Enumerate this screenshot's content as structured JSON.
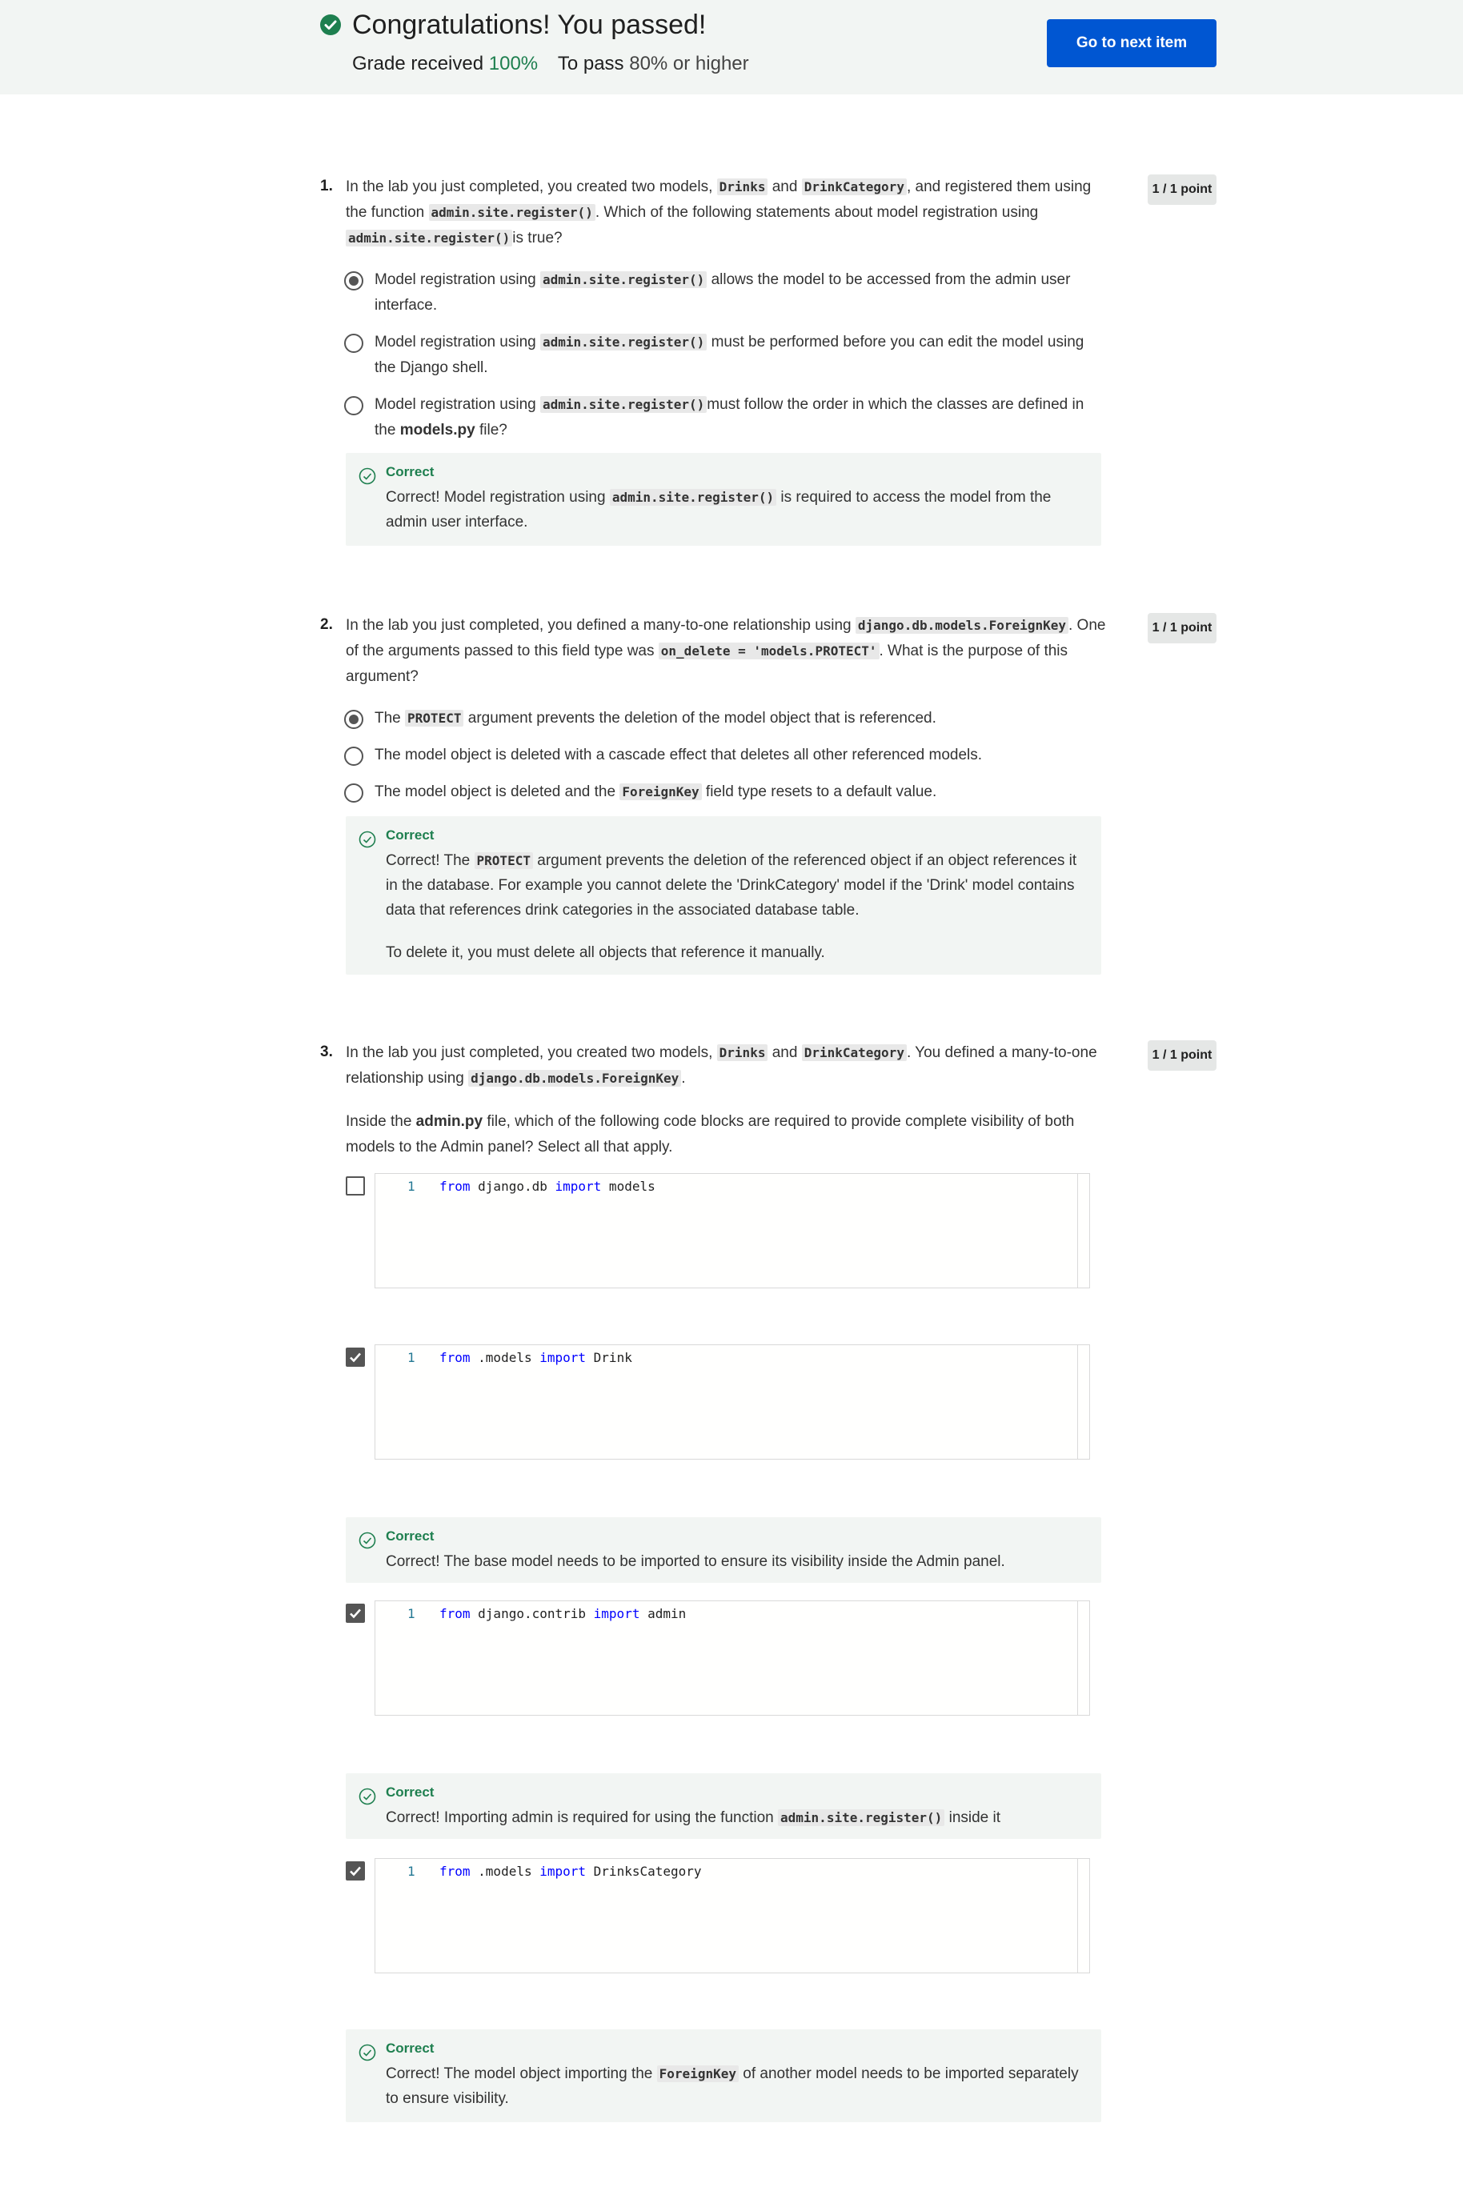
{
  "header": {
    "title": "Congratulations! You passed!",
    "grade_label": "Grade received",
    "grade_value": "100%",
    "pass_label": "To pass",
    "pass_value": "80% or higher",
    "next_button": "Go to next item"
  },
  "colors": {
    "accent": "#0056d2",
    "correct": "#1e7f4f",
    "header_bg": "#f2f5f3"
  },
  "questions": [
    {
      "number": "1.",
      "points": "1 / 1 point",
      "text_a": "In the lab you just completed, you created two models, ",
      "code_a": "Drinks",
      "text_b": " and ",
      "code_b": "DrinkCategory",
      "text_c": ", and registered them using the function ",
      "code_c": "admin.site.register()",
      "text_d": ". Which of the following statements about model registration using ",
      "code_d": "admin.site.register()",
      "text_e": "is true?",
      "options": [
        {
          "pre": "Model registration using ",
          "code": "admin.site.register()",
          "post": " allows the model to be accessed from the admin user interface."
        },
        {
          "pre": "Model registration using ",
          "code": "admin.site.register()",
          "post": " must be performed before you can edit the model using the Django shell."
        },
        {
          "pre": "Model registration using ",
          "code": "admin.site.register()",
          "post": "must follow the order in which the classes are defined in the ",
          "bold": "models.py",
          "post2": " file?"
        }
      ],
      "feedback": {
        "label": "Correct",
        "pre": "Correct! Model registration using ",
        "code": "admin.site.register()",
        "post": " is required to access the model from the admin user interface."
      }
    },
    {
      "number": "2.",
      "points": "1 / 1 point",
      "text_a": "In the lab you just completed, you defined a many-to-one relationship using ",
      "code_a": "django.db.models.ForeignKey",
      "text_b": ". One of the arguments passed to this field type was ",
      "code_b": "on_delete = 'models.PROTECT'",
      "text_c": ". What is the purpose of this argument?",
      "options": [
        {
          "pre": "The ",
          "code": "PROTECT",
          "post": " argument prevents the deletion of the model object that is referenced."
        },
        {
          "pre": "The model object is deleted with a cascade effect that deletes all other referenced models."
        },
        {
          "pre": "The model object is deleted and the ",
          "code": "ForeignKey",
          "post": " field type resets to a default value."
        }
      ],
      "feedback": {
        "label": "Correct",
        "pre": "Correct! The ",
        "code": "PROTECT",
        "post": " argument prevents the deletion of the referenced object if an object references it in the database. For example you cannot delete the 'DrinkCategory' model if the 'Drink' model contains data that references drink categories in the associated database table.",
        "para2": "To delete it, you must delete all objects that reference it manually."
      }
    },
    {
      "number": "3.",
      "points": "1 / 1 point",
      "text_a": "In the lab you just completed, you created two models, ",
      "code_a": "Drinks",
      "text_b": " and ",
      "code_b": "DrinkCategory",
      "text_c": ". You defined a many-to-one relationship using ",
      "code_c": "django.db.models.ForeignKey",
      "text_d": ".",
      "text2_a": "Inside the ",
      "bold2": "admin.py",
      "text2_b": " file, which of the following code blocks are required to provide complete visibility of both models to the Admin panel? Select all that apply.",
      "choices": [
        {
          "line_no": "1",
          "kw1": "from",
          "mod": " django.db ",
          "kw2": "import",
          "name": " models"
        },
        {
          "line_no": "1",
          "kw1": "from",
          "mod": " .models ",
          "kw2": "import",
          "name": " Drink",
          "feedback": {
            "label": "Correct",
            "text": "Correct! The base model needs to be imported to ensure its visibility inside the Admin panel."
          }
        },
        {
          "line_no": "1",
          "kw1": "from",
          "mod": " django.contrib ",
          "kw2": "import",
          "name": " admin",
          "feedback": {
            "label": "Correct",
            "pre": "Correct! Importing admin is required for using the function ",
            "code": "admin.site.register()",
            "post": " inside it"
          }
        },
        {
          "line_no": "1",
          "kw1": "from",
          "mod": " .models ",
          "kw2": "import",
          "name": " DrinksCategory",
          "feedback": {
            "label": "Correct",
            "pre": "Correct! The model object importing the ",
            "code": "ForeignKey",
            "post": " of another model needs to be imported separately to ensure visibility."
          }
        }
      ]
    }
  ]
}
